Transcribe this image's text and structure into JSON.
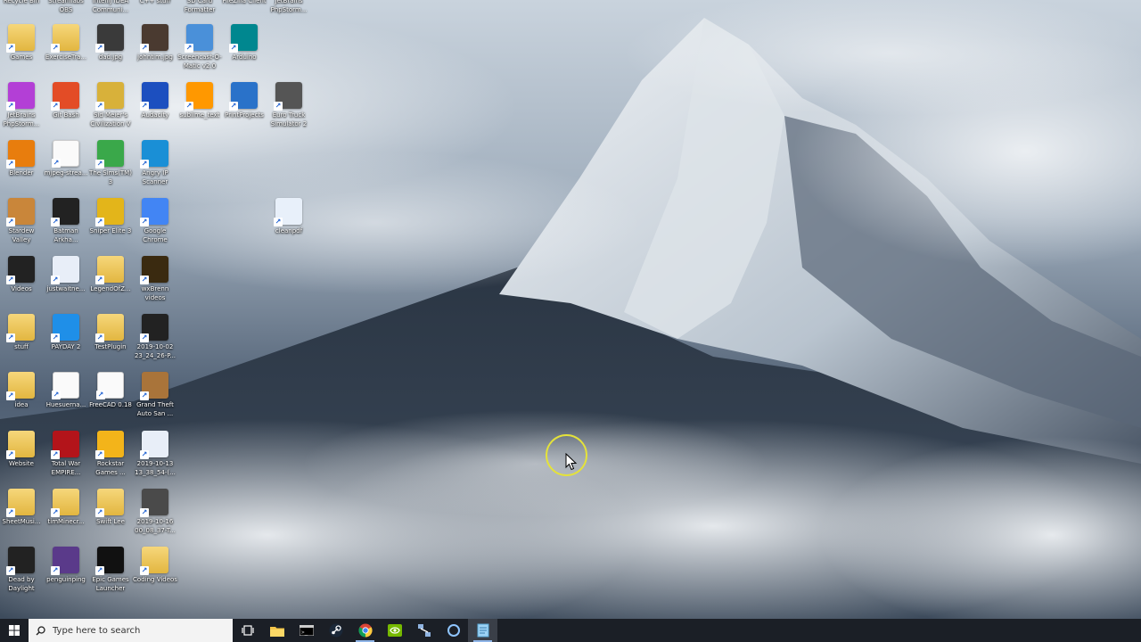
{
  "desktop": {
    "partial_top_labels": [
      "Recycle Bin",
      "Streamlabs OBS",
      "IntelliJ IDEA Communi...",
      "C++ stuff",
      "SD Card Formatter",
      "FileZilla Client",
      "JetBrains PhpStorm..."
    ],
    "icons": [
      {
        "label": "Games",
        "icon": "games-folder-icon",
        "color": "#f0c850"
      },
      {
        "label": "ExerciseTra...",
        "icon": "folder-icon",
        "color": "#f0c850"
      },
      {
        "label": "dad.jpg",
        "icon": "image-icon",
        "color": "#3a3a3a"
      },
      {
        "label": "johntim.jpg",
        "icon": "image-icon",
        "color": "#4a3a30"
      },
      {
        "label": "Screencast-O-Matic v2.0",
        "icon": "screencast-icon",
        "color": "#4a90d9"
      },
      {
        "label": "Arduino",
        "icon": "arduino-icon",
        "color": "#00878f"
      },
      {
        "label": "JetBrains PhpStorm...",
        "icon": "phpstorm-icon",
        "color": "#b33fd6"
      },
      {
        "label": "Git Bash",
        "icon": "git-bash-icon",
        "color": "#e34c26"
      },
      {
        "label": "Sid Meier's Civilization V",
        "icon": "civilization-icon",
        "color": "#d8b13a"
      },
      {
        "label": "Audacity",
        "icon": "audacity-icon",
        "color": "#1c4fbf"
      },
      {
        "label": "sublime_text",
        "icon": "sublime-text-icon",
        "color": "#ff9800"
      },
      {
        "label": "PrintProjects",
        "icon": "print-projects-icon",
        "color": "#2a72c9"
      },
      {
        "label": "Euro Truck Simulator 2",
        "icon": "truck-icon",
        "color": "#555"
      },
      {
        "label": "Blender",
        "icon": "blender-icon",
        "color": "#e87d0d"
      },
      {
        "label": "mjpeg-strea...",
        "icon": "file-icon",
        "color": "#fafafa"
      },
      {
        "label": "The Sims(TM) 3",
        "icon": "sims-icon",
        "color": "#3aa84a"
      },
      {
        "label": "Angry IP Scanner",
        "icon": "ip-scanner-icon",
        "color": "#1a8fd6"
      },
      {
        "label": "Stardew Valley",
        "icon": "stardew-icon",
        "color": "#c9863a"
      },
      {
        "label": "Batman Arkha...",
        "icon": "batman-icon",
        "color": "#222"
      },
      {
        "label": "Sniper Elite 3",
        "icon": "sniper-icon",
        "color": "#e3b51a"
      },
      {
        "label": "Google Chrome",
        "icon": "chrome-icon",
        "color": "#4285f4"
      },
      {
        "label": "cleanpdf",
        "icon": "document-icon",
        "color": "#e8f0fa"
      },
      {
        "label": "Videos",
        "icon": "videos-folder-icon",
        "color": "#222"
      },
      {
        "label": "justwaitne...",
        "icon": "image-file-icon",
        "color": "#e8eef8"
      },
      {
        "label": "LegendOfZ...",
        "icon": "folder-icon",
        "color": "#f0c850"
      },
      {
        "label": "wxBrenn videos",
        "icon": "folder-icon",
        "color": "#3a2a10"
      },
      {
        "label": "stuff",
        "icon": "folder-icon",
        "color": "#f0c850"
      },
      {
        "label": "PAYDAY 2",
        "icon": "payday-icon",
        "color": "#1f8fe8"
      },
      {
        "label": "TestPlugin",
        "icon": "folder-icon",
        "color": "#f0c850"
      },
      {
        "label": "2019-10-02 23_24_26-P...",
        "icon": "screenshot-icon",
        "color": "#222"
      },
      {
        "label": "idea",
        "icon": "folder-icon",
        "color": "#f0c850"
      },
      {
        "label": "Huesuerna...",
        "icon": "file-icon",
        "color": "#fafafa"
      },
      {
        "label": "FreeCAD 0.18",
        "icon": "file-icon",
        "color": "#fafafa"
      },
      {
        "label": "Grand Theft Auto San ...",
        "icon": "gta-icon",
        "color": "#a9743a"
      },
      {
        "label": "Website",
        "icon": "website-folder-icon",
        "color": "#f0c850"
      },
      {
        "label": "Total War EMPIRE...",
        "icon": "total-war-icon",
        "color": "#b3141a"
      },
      {
        "label": "Rockstar Games ...",
        "icon": "rockstar-icon",
        "color": "#f3b41a"
      },
      {
        "label": "2019-10-13 13_38_54-(...",
        "icon": "screenshot-icon",
        "color": "#e8eef8"
      },
      {
        "label": "SheetMusi...",
        "icon": "folder-icon",
        "color": "#f0c850"
      },
      {
        "label": "timMinecr...",
        "icon": "folder-icon",
        "color": "#f0c850"
      },
      {
        "label": "Swift Lee",
        "icon": "folder-icon",
        "color": "#f0c850"
      },
      {
        "label": "2019-10-16 00_08_37-T...",
        "icon": "screenshot-icon",
        "color": "#4a4a4a"
      },
      {
        "label": "Dead by Daylight",
        "icon": "dead-by-daylight-icon",
        "color": "#222"
      },
      {
        "label": "penguinping",
        "icon": "penguin-icon",
        "color": "#5a3a8a"
      },
      {
        "label": "Epic Games Launcher",
        "icon": "epic-games-icon",
        "color": "#111"
      },
      {
        "label": "Coding Videos",
        "icon": "folder-icon",
        "color": "#f0c850"
      }
    ]
  },
  "taskbar": {
    "start_icon": "windows-logo-icon",
    "search_placeholder": "Type here to search",
    "apps": [
      {
        "name": "task-view",
        "icon": "task-view-icon"
      },
      {
        "name": "file-explorer",
        "icon": "folder-icon"
      },
      {
        "name": "terminal",
        "icon": "terminal-icon"
      },
      {
        "name": "steam",
        "icon": "steam-icon"
      },
      {
        "name": "chrome",
        "icon": "chrome-icon"
      },
      {
        "name": "nvidia",
        "icon": "nvidia-icon"
      },
      {
        "name": "network-tool",
        "icon": "network-icon"
      },
      {
        "name": "cortana",
        "icon": "cortana-icon"
      },
      {
        "name": "notepad",
        "icon": "notepad-icon"
      }
    ]
  },
  "colors": {
    "taskbar": "#1b1f26",
    "search_box": "#f3f3f3",
    "cursor_ring": "#e4e23a",
    "folder": "#f0c850"
  }
}
